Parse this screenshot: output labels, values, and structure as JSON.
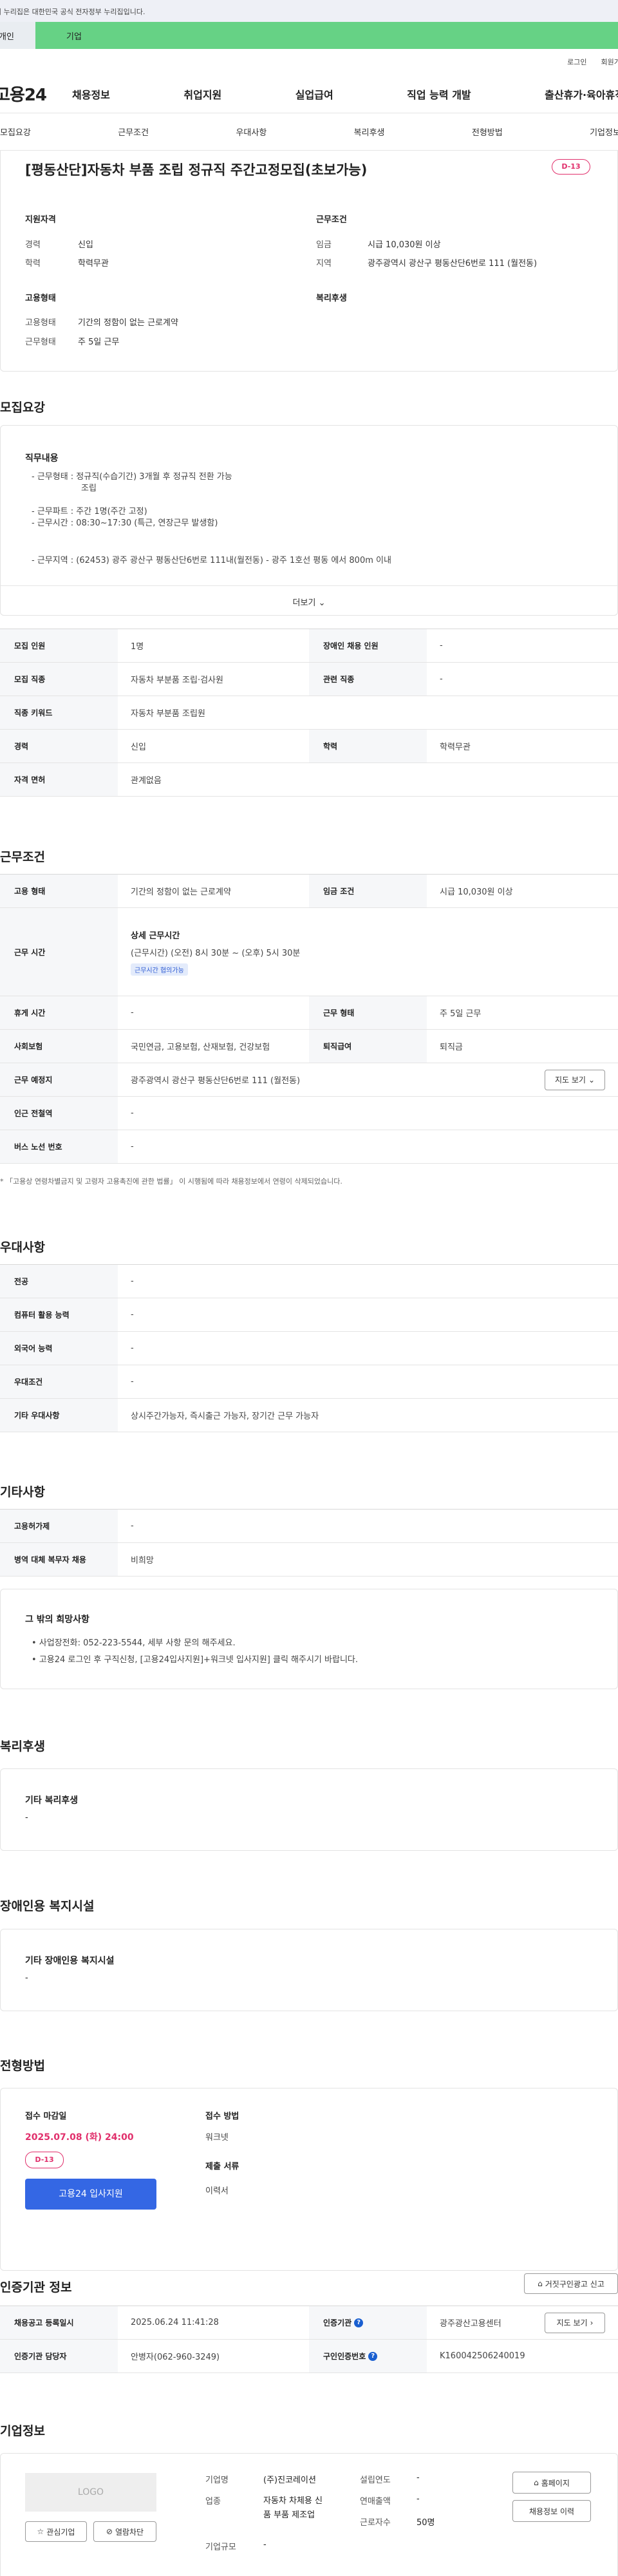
{
  "gov_banner": "이 누리집은 대한민국 공식 전자정부 누리집입니다.",
  "top_tabs": [
    "개인",
    "기업"
  ],
  "util_links": [
    "로그인",
    "회원가입"
  ],
  "logo": "고용24",
  "gnb": [
    "채용정보",
    "취업지원",
    "실업급여",
    "직업 능력 개발",
    "출산휴가·육아휴직"
  ],
  "subnav": [
    "모집요강",
    "근무조건",
    "우대사항",
    "복리후생",
    "전형방법",
    "기업정보"
  ],
  "summary": {
    "title": "[평동산단]자동차 부품 조립 정규직 주간고정모집(초보가능)",
    "dday": "D-13",
    "qual_head": "지원자격",
    "career_k": "경력",
    "career_v": "신입",
    "edu_k": "학력",
    "edu_v": "학력무관",
    "cond_head": "근무조건",
    "wage_k": "임금",
    "wage_v": "시급 10,030원 이상",
    "area_k": "지역",
    "area_v": "광주광역시 광산구 평동산단6번로 111 (월전동)",
    "emp_head": "고용형태",
    "emp_k": "고용형태",
    "emp_v": "기간의 정함이 없는 근로계약",
    "work_k": "근무형태",
    "work_v": "주 5일 근무",
    "welfare_head": "복리후생"
  },
  "recruit": {
    "title": "모집요강",
    "duty_head": "직무내용",
    "duty_lines": [
      "- 근무형태 : 정규직(수습기간) 3개월 후 정규직 전환 가능",
      "  조립",
      "- 근무파트 : 주간 1명(주간 고정)",
      "- 근무시간 : 08:30~17:30 (특근, 연장근무 발생함)",
      "- 근무지역 : (62453) 광주 광산구 평동산단6번로 111내(월전동) - 광주 1호선 평동 에서 800m 이내"
    ],
    "more": "더보기",
    "rows": [
      [
        "모집 인원",
        "1명",
        "장애인 채용 인원",
        "-"
      ],
      [
        "모집 직종",
        "자동차 부분품 조립·검사원",
        "관련 직종",
        "-"
      ],
      [
        "직종 키워드",
        "자동차 부분품 조립원"
      ],
      [
        "경력",
        "신입",
        "학력",
        "학력무관"
      ],
      [
        "자격 면허",
        "관계없음"
      ]
    ]
  },
  "conditions": {
    "title": "근무조건",
    "emp_k": "고용 형태",
    "emp_v": "기간의 정함이 없는 근로계약",
    "wage_k": "임금 조건",
    "wage_v": "시급 10,030원 이상",
    "time_k": "근무 시간",
    "time_head": "상세 근무시간",
    "time_v": "(근무시간) (오전) 8시 30분 ~ (오후) 5시 30분",
    "time_chip": "근무시간 협의가능",
    "rest_k": "휴게 시간",
    "rest_v": "-",
    "shape_k": "근무 형태",
    "shape_v": "주 5일 근무",
    "ins_k": "사회보험",
    "ins_v": "국민연금, 고용보험, 산재보험, 건강보험",
    "sev_k": "퇴직급여",
    "sev_v": "퇴직금",
    "place_k": "근무 예정지",
    "place_v": "광주광역시 광산구 평동산단6번로 111 (월전동)",
    "map_btn": "지도 보기",
    "station_k": "인근 전철역",
    "station_v": "-",
    "bus_k": "버스 노선 번호",
    "bus_v": "-",
    "note": "* 「고용상 연령차별금지 및 고령자 고용촉진에 관한 법률」 이 시행됨에 따라 채용정보에서 연령이 삭제되었습니다."
  },
  "prefer": {
    "title": "우대사항",
    "rows": [
      [
        "전공",
        "-"
      ],
      [
        "컴퓨터 활용 능력",
        "-"
      ],
      [
        "외국어 능력",
        "-"
      ],
      [
        "우대조건",
        "-"
      ],
      [
        "기타 우대사항",
        "상시주간가능자, 즉시출근 가능자, 장기간 근무 가능자"
      ]
    ]
  },
  "etc": {
    "title": "기타사항",
    "rows": [
      [
        "고용허가제",
        "-"
      ],
      [
        "병역 대체 복무자 채용",
        "비희망"
      ]
    ],
    "hope_head": "그 밖의 희망사항",
    "hope_lines": [
      "• 사업장전화: 052-223-5544, 세부 사항 문의 해주세요.",
      "• 고용24 로그인 후 구직신청, [고용24입사지원]+워크넷 입사지원] 클릭 해주시기 바랍니다."
    ]
  },
  "welfare": {
    "title": "복리후생",
    "head": "기타 복리후생",
    "value": "-"
  },
  "disability": {
    "title": "장애인용 복지시설",
    "head": "기타 장애인용 복지시설",
    "value": "-"
  },
  "selection": {
    "title": "전형방법",
    "deadline_k": "접수 마감일",
    "deadline_v": "2025.07.08 (화) 24:00",
    "dday": "D-13",
    "apply_btn": "고용24 입사지원",
    "method_k": "접수 방법",
    "method_v": "워크넷",
    "docs_k": "제출 서류",
    "docs_v": "이력서"
  },
  "cert": {
    "title": "인증기관 정보",
    "report_btn": "거짓구인광고 신고",
    "reg_k": "채용공고 등록일시",
    "reg_v": "2025.06.24 11:41:28",
    "org_k": "인증기관",
    "org_v": "광주광산고용센터",
    "map_btn": "지도 보기",
    "mgr_k": "인증기관 담당자",
    "mgr_v": "안병자(062-960-3249)",
    "no_k": "구인인증번호",
    "no_v": "K160042506240019"
  },
  "company": {
    "title": "기업정보",
    "logo": "LOGO",
    "fav_btn": "관심기업",
    "block_btn": "열람차단",
    "name_k": "기업명",
    "name_v": "(주)진코레이션",
    "ind_k": "업종",
    "ind_v": [
      "자동차 차체용 신",
      "품 부품 제조업"
    ],
    "size_k": "기업규모",
    "size_v": "-",
    "est_k": "설립연도",
    "est_v": "-",
    "sales_k": "연매출액",
    "sales_v": "-",
    "emp_k": "근로자수",
    "emp_v": "50명",
    "home_btn": "홈페이지",
    "jobs_btn": "채용정보 이력"
  }
}
